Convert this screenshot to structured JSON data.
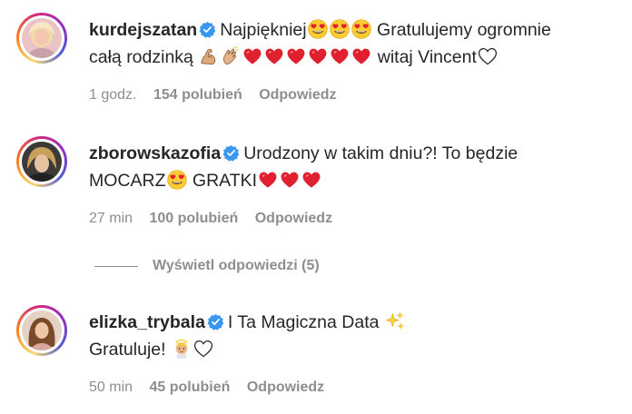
{
  "comments": [
    {
      "username": "kurdejszatan",
      "verified": true,
      "text_parts": [
        "Najpiękniej",
        "Gratulujemy ogromnie",
        "całą rodzinką",
        "witaj Vincent"
      ],
      "time": "1 godz.",
      "likes": "154 polubień",
      "reply": "Odpowiedz"
    },
    {
      "username": "zborowskazofia",
      "verified": true,
      "text_parts": [
        "Urodzony w takim dniu?! To będzie",
        "MOCARZ",
        "GRATKI"
      ],
      "time": "27 min",
      "likes": "100 polubień",
      "reply": "Odpowiedz"
    },
    {
      "username": "elizka_trybala",
      "verified": true,
      "text_parts": [
        "I Ta Magiczna Data",
        "Gratuluje!"
      ],
      "time": "50 min",
      "likes": "45 polubień",
      "reply": "Odpowiedz"
    }
  ],
  "view_replies": "Wyświetl odpowiedzi (5)",
  "icons": {
    "verified": "verified-badge-icon",
    "heart_eyes": "heart-eyes-emoji-icon",
    "flexed_biceps": "flexed-biceps-emoji-icon",
    "clapping": "clapping-hands-emoji-icon",
    "red_heart": "red-heart-emoji-icon",
    "white_heart": "white-heart-emoji-icon",
    "sparkles": "sparkles-emoji-icon",
    "angel": "baby-angel-emoji-icon"
  },
  "colors": {
    "verified": "#3897f0",
    "secondary": "#8e8e8e",
    "text": "#262626",
    "heart": "#e0202e"
  }
}
